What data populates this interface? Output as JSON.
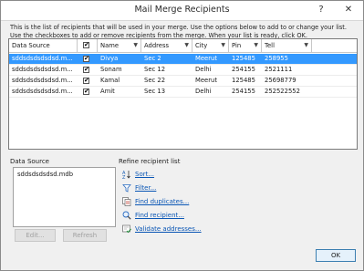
{
  "window": {
    "title": "Mail Merge Recipients",
    "help_label": "?",
    "close_label": "✕"
  },
  "instructions": "This is the list of recipients that will be used in your merge. Use the options below to add to or change your list. Use the checkboxes to add or remove recipients from the merge.  When your list is ready, click OK.",
  "columns": [
    {
      "label": "Data Source"
    },
    {
      "label": "✔"
    },
    {
      "label": "Name"
    },
    {
      "label": "Address"
    },
    {
      "label": "City"
    },
    {
      "label": "Pin"
    },
    {
      "label": "Tell"
    }
  ],
  "rows": [
    {
      "source": "sddsdsdsdsdsd.m...",
      "checked": "✔",
      "name": "Divya",
      "address": "Sec 2",
      "city": "Meerut",
      "pin": "125485",
      "tell": "258955",
      "selected": true
    },
    {
      "source": "sddsdsdsdsdsd.m...",
      "checked": "✔",
      "name": "Sonam",
      "address": "Sec 12",
      "city": "Delhi",
      "pin": "254155",
      "tell": "2521111",
      "selected": false
    },
    {
      "source": "sddsdsdsdsdsd.m...",
      "checked": "✔",
      "name": "Kamal",
      "address": "Sec 22",
      "city": "Meerut",
      "pin": "125485",
      "tell": "25698779",
      "selected": false
    },
    {
      "source": "sddsdsdsdsdsd.m...",
      "checked": "✔",
      "name": "Amit",
      "address": "Sec 13",
      "city": "Delhi",
      "pin": "254155",
      "tell": "252522552",
      "selected": false
    }
  ],
  "data_source": {
    "heading": "Data Source",
    "items": [
      "sddsdsdsdsd.mdb"
    ],
    "edit_label": "Edit...",
    "refresh_label": "Refresh"
  },
  "refine": {
    "heading": "Refine recipient list",
    "items": [
      {
        "label": "Sort...",
        "icon": "sort-icon"
      },
      {
        "label": "Filter...",
        "icon": "filter-icon"
      },
      {
        "label": "Find duplicates...",
        "icon": "find-duplicates-icon"
      },
      {
        "label": "Find recipient...",
        "icon": "find-recipient-icon"
      },
      {
        "label": "Validate addresses...",
        "icon": "validate-addresses-icon"
      }
    ]
  },
  "ok_label": "OK",
  "colors": {
    "selection": "#3399ff",
    "link": "#0a56b5"
  }
}
